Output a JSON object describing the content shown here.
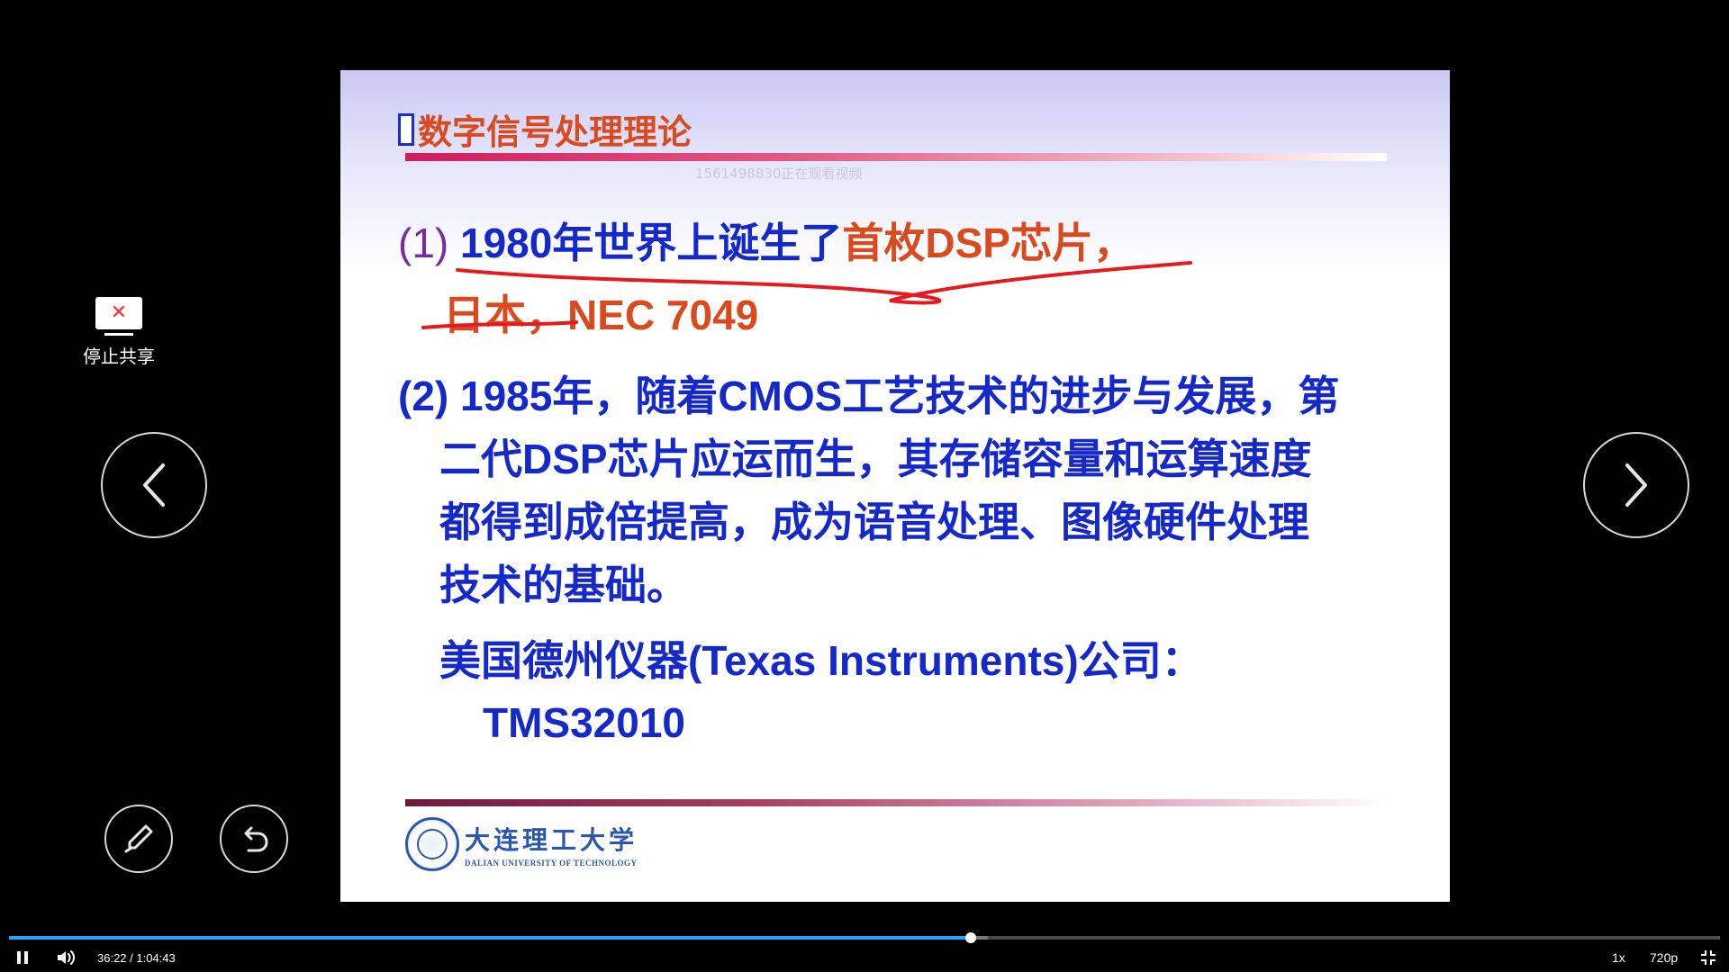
{
  "slide": {
    "title_marker": "",
    "title": "数字信号处理理论",
    "watermark": "1561498830正在观看视频",
    "line1_prefix": "(1)",
    "line1_blue": "1980年世界上诞生了",
    "line1_orange": "首枚DSP芯片，",
    "line2": "日本，NEC 7049",
    "line3": "(2) 1985年，随着CMOS工艺技术的进步与发展，第",
    "line4": "二代DSP芯片应运而生，其存储容量和运算速度",
    "line5": "都得到成倍提高，成为语音处理、图像硬件处理",
    "line6": "技术的基础。",
    "line7": "美国德州仪器(Texas Instruments)公司：",
    "line8": "TMS32010",
    "logo_cn": "大连理工大学",
    "logo_en": "DALIAN UNIVERSITY OF TECHNOLOGY",
    "annotation_color": "#e8191e"
  },
  "share": {
    "stop_label": "停止共享",
    "icon": "stop-share-icon"
  },
  "nav": {
    "prev_icon": "chevron-left-icon",
    "next_icon": "chevron-right-icon"
  },
  "tools": {
    "pen_icon": "pen-icon",
    "undo_icon": "undo-icon"
  },
  "player": {
    "time": "36:22 / 1:04:43",
    "progress_fraction": 0.562,
    "buffer_fraction": 0.572,
    "rate": "1x",
    "quality": "720p",
    "accent_color": "#1ea7ff"
  }
}
